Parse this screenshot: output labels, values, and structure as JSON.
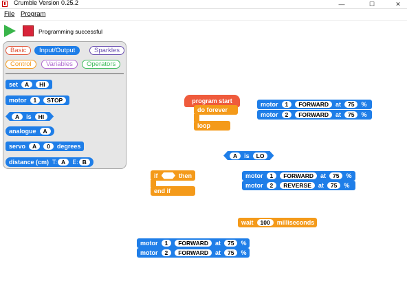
{
  "window": {
    "title": "Crumble Version 0.25.2",
    "minimize": "—",
    "maximize": "☐",
    "close": "✕"
  },
  "menu": {
    "file": "File",
    "program": "Program"
  },
  "toolbar": {
    "status": "Programming successful"
  },
  "palette": {
    "categories": [
      {
        "label": "Basic",
        "color": "#e0563b"
      },
      {
        "label": "Input/Output",
        "color": "#1f7ee8"
      },
      {
        "label": "Sparkles",
        "color": "#6a4fb0"
      },
      {
        "label": "Control",
        "color": "#f49a1a"
      },
      {
        "label": "Variables",
        "color": "#b06ad0"
      },
      {
        "label": "Operators",
        "color": "#3dbb5a"
      }
    ],
    "set": {
      "label": "set",
      "pin": "A",
      "value": "HI"
    },
    "motor": {
      "label": "motor",
      "num": "1",
      "dir": "STOP"
    },
    "is": {
      "pin": "A",
      "is": "is",
      "value": "HI"
    },
    "analogue": {
      "label": "analogue",
      "pin": "A"
    },
    "servo": {
      "label": "servo",
      "pin": "A",
      "value": "0",
      "unit": "degrees"
    },
    "distance": {
      "label": "distance (cm)",
      "t": "T:",
      "tval": "A",
      "e": "E:",
      "eval": "B"
    }
  },
  "canvas": {
    "program_start": "program start",
    "do_forever": "do forever",
    "loop": "loop",
    "motors1": [
      {
        "label": "motor",
        "num": "1",
        "dir": "FORWARD",
        "at": "at",
        "speed": "75",
        "pct": "%"
      },
      {
        "label": "motor",
        "num": "2",
        "dir": "FORWARD",
        "at": "at",
        "speed": "75",
        "pct": "%"
      }
    ],
    "cond": {
      "pin": "A",
      "is": "is",
      "value": "LO"
    },
    "motors2": [
      {
        "label": "motor",
        "num": "1",
        "dir": "FORWARD",
        "at": "at",
        "speed": "75",
        "pct": "%"
      },
      {
        "label": "motor",
        "num": "2",
        "dir": "REVERSE",
        "at": "at",
        "speed": "75",
        "pct": "%"
      }
    ],
    "if": {
      "if": "if",
      "then": "then",
      "endif": "end if"
    },
    "wait": {
      "label": "wait",
      "value": "100",
      "unit": "milliseconds"
    },
    "motors3": [
      {
        "label": "motor",
        "num": "1",
        "dir": "FORWARD",
        "at": "at",
        "speed": "75",
        "pct": "%"
      },
      {
        "label": "motor",
        "num": "2",
        "dir": "FORWARD",
        "at": "at",
        "speed": "75",
        "pct": "%"
      }
    ]
  },
  "colors": {
    "blue": "#1f7ee8",
    "orange": "#f49a1a",
    "red": "#ef5b3c",
    "run": "#39b54a",
    "stop": "#d8243a"
  }
}
